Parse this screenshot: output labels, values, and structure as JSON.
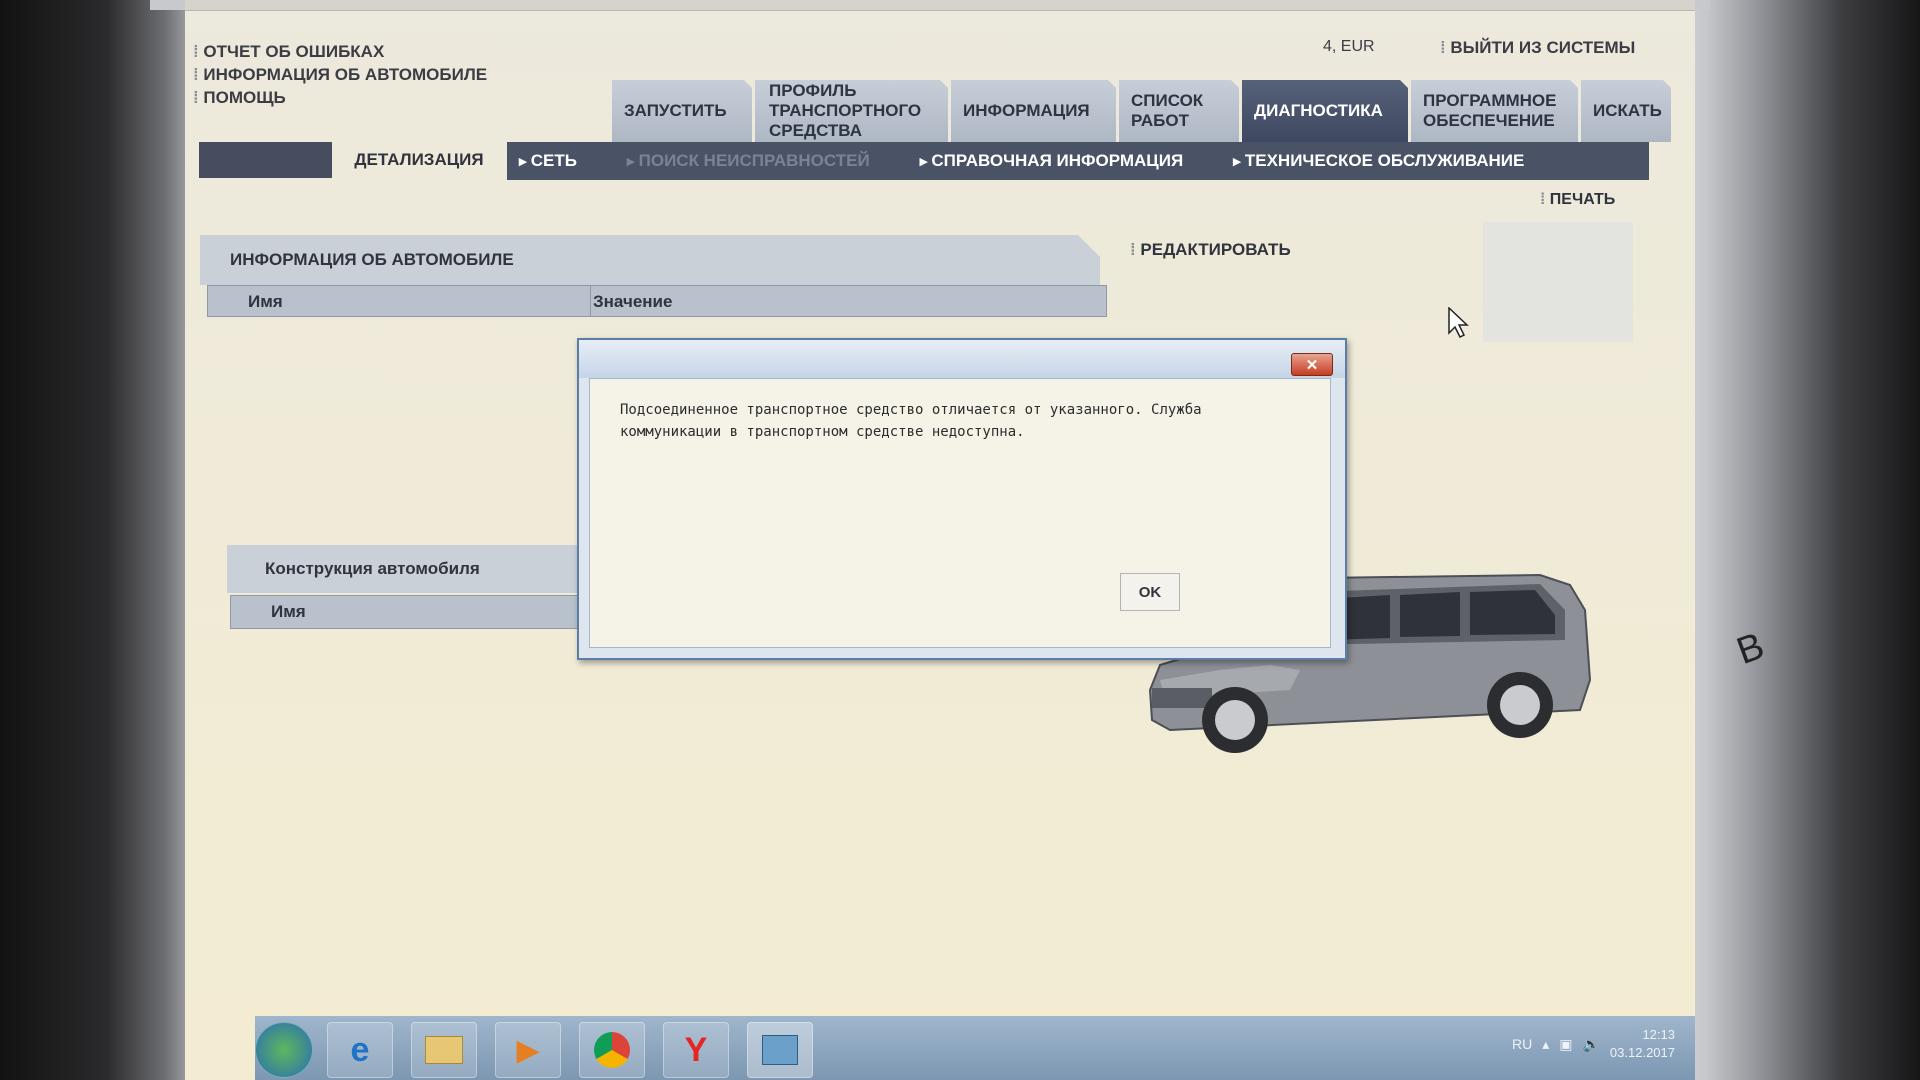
{
  "top_links": [
    "ОТЧЕТ ОБ ОШИБКАХ",
    "ИНФОРМАЦИЯ ОБ АВТОМОБИЛЕ",
    "ПОМОЩЬ"
  ],
  "locale": "4, EUR",
  "logout": "ВЫЙТИ ИЗ СИСТЕМЫ",
  "tabs": [
    {
      "label": "ЗАПУСТИТЬ"
    },
    {
      "label": "ПРОФИЛЬ ТРАНСПОРТНОГО СРЕДСТВА"
    },
    {
      "label": "ИНФОРМАЦИЯ"
    },
    {
      "label": "СПИСОК РАБОТ"
    },
    {
      "label": "ДИАГНОСТИКА",
      "active": true
    },
    {
      "label": "ПРОГРАММНОЕ ОБЕСПЕЧЕНИЕ"
    },
    {
      "label": "ИСКАТЬ"
    }
  ],
  "subnav": {
    "detail": "ДЕТАЛИЗАЦИЯ",
    "items": [
      {
        "label": "СЕТЬ",
        "disabled": false
      },
      {
        "label": "ПОИСК НЕИСПРАВНОСТЕЙ",
        "disabled": true
      },
      {
        "label": "СПРАВОЧНАЯ ИНФОРМАЦИЯ",
        "disabled": false
      },
      {
        "label": "ТЕХНИЧЕСКОЕ ОБСЛУЖИВАНИЕ",
        "disabled": false
      }
    ]
  },
  "print": "ПЕЧАТЬ",
  "vehicle_panel": {
    "title": "ИНФОРМАЦИЯ ОБ АВТОМОБИЛЕ",
    "col_name": "Имя",
    "col_value": "Значение"
  },
  "edit": "РЕДАКТИРОВАТЬ",
  "construction": {
    "title": "Конструкция автомобиля",
    "col_name": "Имя"
  },
  "dialog": {
    "message": "Подсоединенное транспортное средство отличается от указанного. Служба коммуникации в транспортном средстве недоступна.",
    "ok": "OK",
    "close": "✕"
  },
  "taskbar": {
    "lang": "RU",
    "time": "12:13",
    "date": "03.12.2017"
  },
  "bezel_letter": "B",
  "colors": {
    "accent_tab": "#4a5266",
    "tab": "#b9c1cc",
    "background": "#f0ebd8",
    "dialog_border": "#5c7ea6",
    "close": "#c53d22"
  }
}
